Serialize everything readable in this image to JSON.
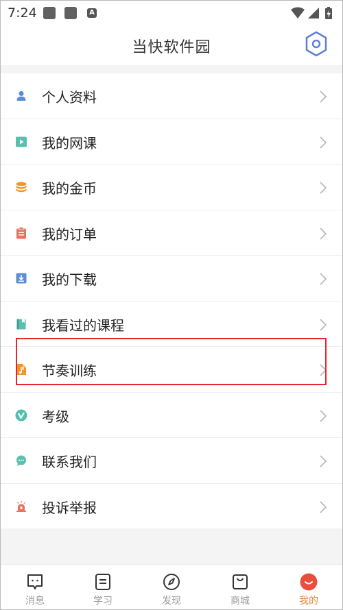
{
  "status": {
    "time": "7:24",
    "badge_letter": "A"
  },
  "header": {
    "title": "当快软件园"
  },
  "menu": [
    {
      "label": "个人资料",
      "icon": "person-icon",
      "color": "#5b8ed8"
    },
    {
      "label": "我的网课",
      "icon": "video-course-icon",
      "color": "#5bbfb0"
    },
    {
      "label": "我的金币",
      "icon": "coin-stack-icon",
      "color": "#f0952c"
    },
    {
      "label": "我的订单",
      "icon": "clipboard-icon",
      "color": "#e8735e"
    },
    {
      "label": "我的下载",
      "icon": "download-icon",
      "color": "#5b8ed8"
    },
    {
      "label": "我看过的课程",
      "icon": "book-icon",
      "color": "#5bbfb0"
    },
    {
      "label": "节奏训练",
      "icon": "music-file-icon",
      "color": "#f0952c"
    },
    {
      "label": "考级",
      "icon": "check-badge-icon",
      "color": "#4fbfb0"
    },
    {
      "label": "联系我们",
      "icon": "chat-bubble-icon",
      "color": "#5bbfb0"
    },
    {
      "label": "投诉举报",
      "icon": "alarm-icon",
      "color": "#e8735e"
    }
  ],
  "tabs": [
    {
      "label": "消息",
      "icon": "message-icon",
      "active": false
    },
    {
      "label": "学习",
      "icon": "study-icon",
      "active": false
    },
    {
      "label": "发现",
      "icon": "compass-icon",
      "active": false
    },
    {
      "label": "商城",
      "icon": "shopping-bag-icon",
      "active": false
    },
    {
      "label": "我的",
      "icon": "profile-smile-icon",
      "active": true
    }
  ],
  "colors": {
    "accent": "#e8873a",
    "active_tab_icon": "#e84d3d",
    "highlight_border": "#e0282e",
    "settings_icon": "#5e7ed8"
  }
}
